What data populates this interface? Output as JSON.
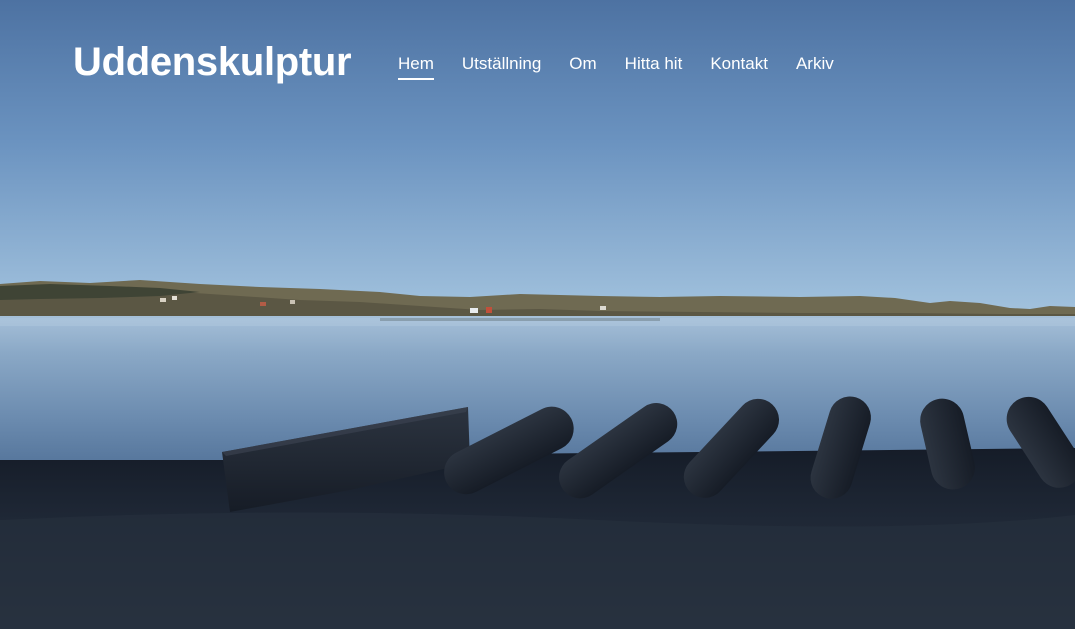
{
  "site": {
    "title": "Uddenskulptur"
  },
  "nav": {
    "items": [
      {
        "label": "Hem",
        "active": true
      },
      {
        "label": "Utställning",
        "active": false
      },
      {
        "label": "Om",
        "active": false
      },
      {
        "label": "Hitta hit",
        "active": false
      },
      {
        "label": "Kontakt",
        "active": false
      },
      {
        "label": "Arkiv",
        "active": false
      }
    ]
  },
  "hero": {
    "image": "coastal-landscape-with-concrete-sculpture-pillars"
  },
  "colors": {
    "header_text": "#ffffff",
    "sky_top": "#4e74a3",
    "sky_horizon": "#9fc0dd",
    "water": "#7393b6",
    "ground": "#1c2431"
  }
}
